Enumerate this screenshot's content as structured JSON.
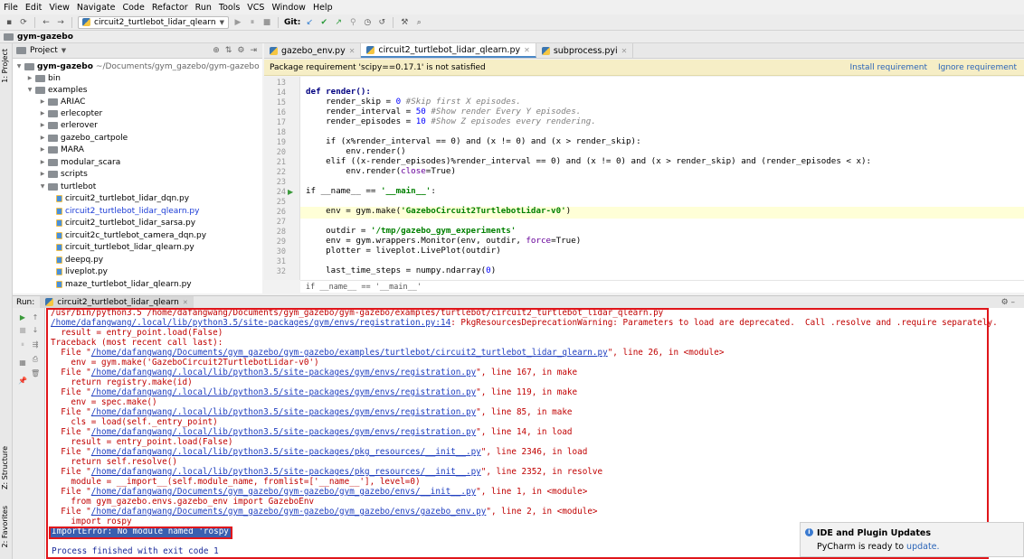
{
  "menu": [
    "File",
    "Edit",
    "View",
    "Navigate",
    "Code",
    "Refactor",
    "Run",
    "Tools",
    "VCS",
    "Window",
    "Help"
  ],
  "toolbar": {
    "run_config": "circuit2_turtlebot_lidar_qlearn",
    "git_label": "Git:"
  },
  "navbar": {
    "project_name": "gym-gazebo"
  },
  "project_panel": {
    "title": "Project",
    "root_name": "gym-gazebo",
    "root_path": "~/Documents/gym_gazebo/gym-gazebo",
    "items": [
      {
        "label": "bin"
      },
      {
        "label": "examples"
      },
      {
        "label": "ARIAC"
      },
      {
        "label": "erlecopter"
      },
      {
        "label": "erlerover"
      },
      {
        "label": "gazebo_cartpole"
      },
      {
        "label": "MARA"
      },
      {
        "label": "modular_scara"
      },
      {
        "label": "scripts"
      },
      {
        "label": "turtlebot"
      },
      {
        "label": "circuit2_turtlebot_lidar_dqn.py"
      },
      {
        "label": "circuit2_turtlebot_lidar_qlearn.py"
      },
      {
        "label": "circuit2_turtlebot_lidar_sarsa.py"
      },
      {
        "label": "circuit2c_turtlebot_camera_dqn.py"
      },
      {
        "label": "circuit_turtlebot_lidar_qlearn.py"
      },
      {
        "label": "deepq.py"
      },
      {
        "label": "liveplot.py"
      },
      {
        "label": "maze_turtlebot_lidar_qlearn.py"
      }
    ]
  },
  "side_tabs": {
    "project": "1: Project",
    "structure": "Z: Structure",
    "favorites": "2: Favorites"
  },
  "editor_tabs": [
    {
      "label": "gazebo_env.py"
    },
    {
      "label": "circuit2_turtlebot_lidar_qlearn.py"
    },
    {
      "label": "subprocess.pyi"
    }
  ],
  "banner": {
    "message": "Package requirement 'scipy==0.17.1' is not satisfied",
    "install": "Install requirement",
    "ignore": "Ignore requirement"
  },
  "code_lines": [
    {
      "n": "13"
    },
    {
      "n": "14"
    },
    {
      "n": "15"
    },
    {
      "n": "16"
    },
    {
      "n": "17"
    },
    {
      "n": "18"
    },
    {
      "n": "19"
    },
    {
      "n": "20"
    },
    {
      "n": "21"
    },
    {
      "n": "22"
    },
    {
      "n": "23"
    },
    {
      "n": "24"
    },
    {
      "n": "25"
    },
    {
      "n": "26"
    },
    {
      "n": "27"
    },
    {
      "n": "28"
    },
    {
      "n": "29"
    },
    {
      "n": "30"
    },
    {
      "n": "31"
    },
    {
      "n": "32"
    }
  ],
  "code": {
    "l14": "def render():",
    "l15a": "    render_skip = ",
    "l15n": "0",
    "l15c": " #Skip first X episodes.",
    "l16a": "    render_interval = ",
    "l16n": "50",
    "l16c": " #Show render Every Y episodes.",
    "l17a": "    render_episodes = ",
    "l17n": "10",
    "l17c": " #Show Z episodes every rendering.",
    "l19": "    if (x%render_interval == 0) and (x != 0) and (x > render_skip):",
    "l20": "        env.render()",
    "l21": "    elif ((x-render_episodes)%render_interval == 0) and (x != 0) and (x > render_skip) and (render_episodes < x):",
    "l22a": "        env.render(",
    "l22k": "close",
    "l22b": "=True)",
    "l24a": "if __name__ == ",
    "l24s": "'__main__'",
    "l24b": ":",
    "l26a": "    env = gym.make(",
    "l26s": "'GazeboCircuit2TurtlebotLidar-v0'",
    "l26b": ")",
    "l28a": "    outdir = ",
    "l28s": "'/tmp/gazebo_gym_experiments'",
    "l29a": "    env = gym.wrappers.Monitor(env, outdir, ",
    "l29k": "force",
    "l29b": "=True)",
    "l30": "    plotter = liveplot.LivePlot(outdir)",
    "l32a": "    last_time_steps = numpy.ndarray(",
    "l32n": "0",
    "l32b": ")"
  },
  "breadcrumb": "if __name__ == '__main__'",
  "run_panel": {
    "label": "Run:",
    "tab": "circuit2_turtlebot_lidar_qlearn",
    "console": {
      "c1": "/usr/bin/python3.5 /home/dafangwang/Documents/gym_gazebo/gym-gazebo/examples/turtlebot/circuit2_turtlebot_lidar_qlearn.py",
      "c2link": "/home/dafangwang/.local/lib/python3.5/site-packages/gym/envs/registration.py:14",
      "c2rest": ": PkgResourcesDeprecationWarning: Parameters to load are deprecated.  Call .resolve and .require separately.",
      "c3": "  result = entry_point.load(False)",
      "c4": "Traceback (most recent call last):",
      "c5a": "  File \"",
      "c5link": "/home/dafangwang/Documents/gym_gazebo/gym-gazebo/examples/turtlebot/circuit2_turtlebot_lidar_qlearn.py",
      "c5b": "\", line 26, in <module>",
      "c6": "    env = gym.make('GazeboCircuit2TurtlebotLidar-v0')",
      "c7a": "  File \"",
      "c7link": "/home/dafangwang/.local/lib/python3.5/site-packages/gym/envs/registration.py",
      "c7b": "\", line 167, in make",
      "c8": "    return registry.make(id)",
      "c9a": "  File \"",
      "c9link": "/home/dafangwang/.local/lib/python3.5/site-packages/gym/envs/registration.py",
      "c9b": "\", line 119, in make",
      "c10": "    env = spec.make()",
      "c11a": "  File \"",
      "c11link": "/home/dafangwang/.local/lib/python3.5/site-packages/gym/envs/registration.py",
      "c11b": "\", line 85, in make",
      "c12": "    cls = load(self._entry_point)",
      "c13a": "  File \"",
      "c13link": "/home/dafangwang/.local/lib/python3.5/site-packages/gym/envs/registration.py",
      "c13b": "\", line 14, in load",
      "c14": "    result = entry_point.load(False)",
      "c15a": "  File \"",
      "c15link": "/home/dafangwang/.local/lib/python3.5/site-packages/pkg_resources/__init__.py",
      "c15b": "\", line 2346, in load",
      "c16": "    return self.resolve()",
      "c17a": "  File \"",
      "c17link": "/home/dafangwang/.local/lib/python3.5/site-packages/pkg_resources/__init__.py",
      "c17b": "\", line 2352, in resolve",
      "c18": "    module = __import__(self.module_name, fromlist=['__name__'], level=0)",
      "c19a": "  File \"",
      "c19link": "/home/dafangwang/Documents/gym_gazebo/gym-gazebo/gym_gazebo/envs/__init__.py",
      "c19b": "\", line 1, in <module>",
      "c20": "    from gym_gazebo.envs.gazebo_env import GazeboEnv",
      "c21a": "  File \"",
      "c21link": "/home/dafangwang/Documents/gym_gazebo/gym-gazebo/gym_gazebo/envs/gazebo_env.py",
      "c21b": "\", line 2, in <module>",
      "c22": "    import rospy",
      "c23": "ImportError: No module named 'rospy'",
      "c24": "Process finished with exit code 1"
    }
  },
  "notification": {
    "title": "IDE and Plugin Updates",
    "body": "PyCharm is ready to ",
    "link": "update."
  }
}
